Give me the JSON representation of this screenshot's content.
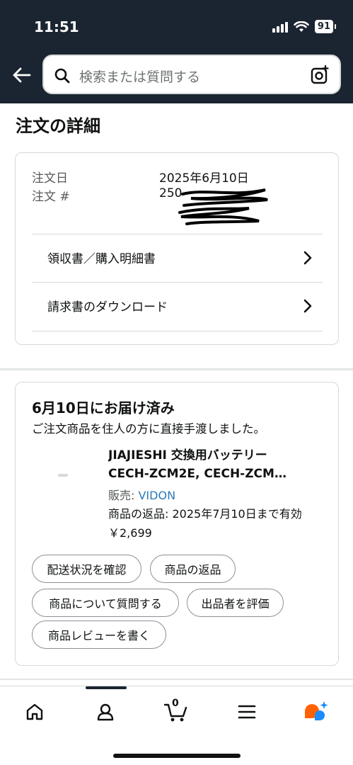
{
  "status_bar": {
    "time": "11:51",
    "battery": "91"
  },
  "search": {
    "placeholder": "検索または質問する"
  },
  "page_title": "注文の詳細",
  "order_info": {
    "date_label": "注文日",
    "date_value": "2025年6月10日",
    "number_label": "注文 #",
    "number_value_visible": "250"
  },
  "links": [
    {
      "label": "領収書／購入明細書"
    },
    {
      "label": "請求書のダウンロード"
    }
  ],
  "delivery": {
    "title": "6月10日にお届け済み",
    "subtitle": "ご注文商品を住人の方に直接手渡しました。",
    "product": {
      "name_line1": "JIAJIESHI 交換用バッテリー",
      "name_line2": "CECH-ZCM2E, CECH-ZCM…",
      "seller_label": "販売: ",
      "seller_name": "VIDON",
      "return_note": "商品の返品: 2025年7月10日まで有効",
      "price": "￥2,699"
    },
    "actions": [
      "配送状況を確認",
      "商品の返品",
      "商品について質問する",
      "出品者を評価",
      "商品レビューを書く"
    ]
  },
  "tabbar": {
    "cart_count": "0"
  },
  "colors": {
    "header_bg": "#1b2431",
    "link_blue": "#2a7ab8",
    "alexa_orange": "#ff6200",
    "alexa_blue": "#1a8cff"
  }
}
